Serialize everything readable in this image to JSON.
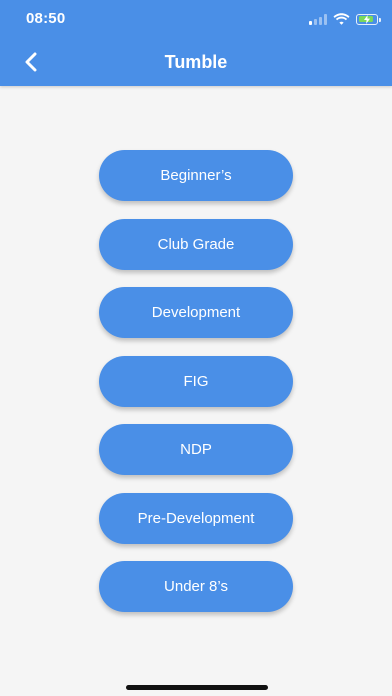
{
  "status_bar": {
    "time": "08:50",
    "icons": [
      "signal-icon",
      "wifi-icon",
      "battery-charging-icon"
    ]
  },
  "header": {
    "title": "Tumble",
    "back_icon": "chevron-left-icon"
  },
  "buttons": [
    {
      "label": "Beginner’s"
    },
    {
      "label": "Club Grade"
    },
    {
      "label": "Development"
    },
    {
      "label": "FIG"
    },
    {
      "label": "NDP"
    },
    {
      "label": "Pre-Development"
    },
    {
      "label": "Under 8’s"
    }
  ],
  "colors": {
    "primary": "#4a8fe7",
    "background": "#f5f5f5",
    "text_on_primary": "#ffffff",
    "battery": "#7bd95c"
  }
}
